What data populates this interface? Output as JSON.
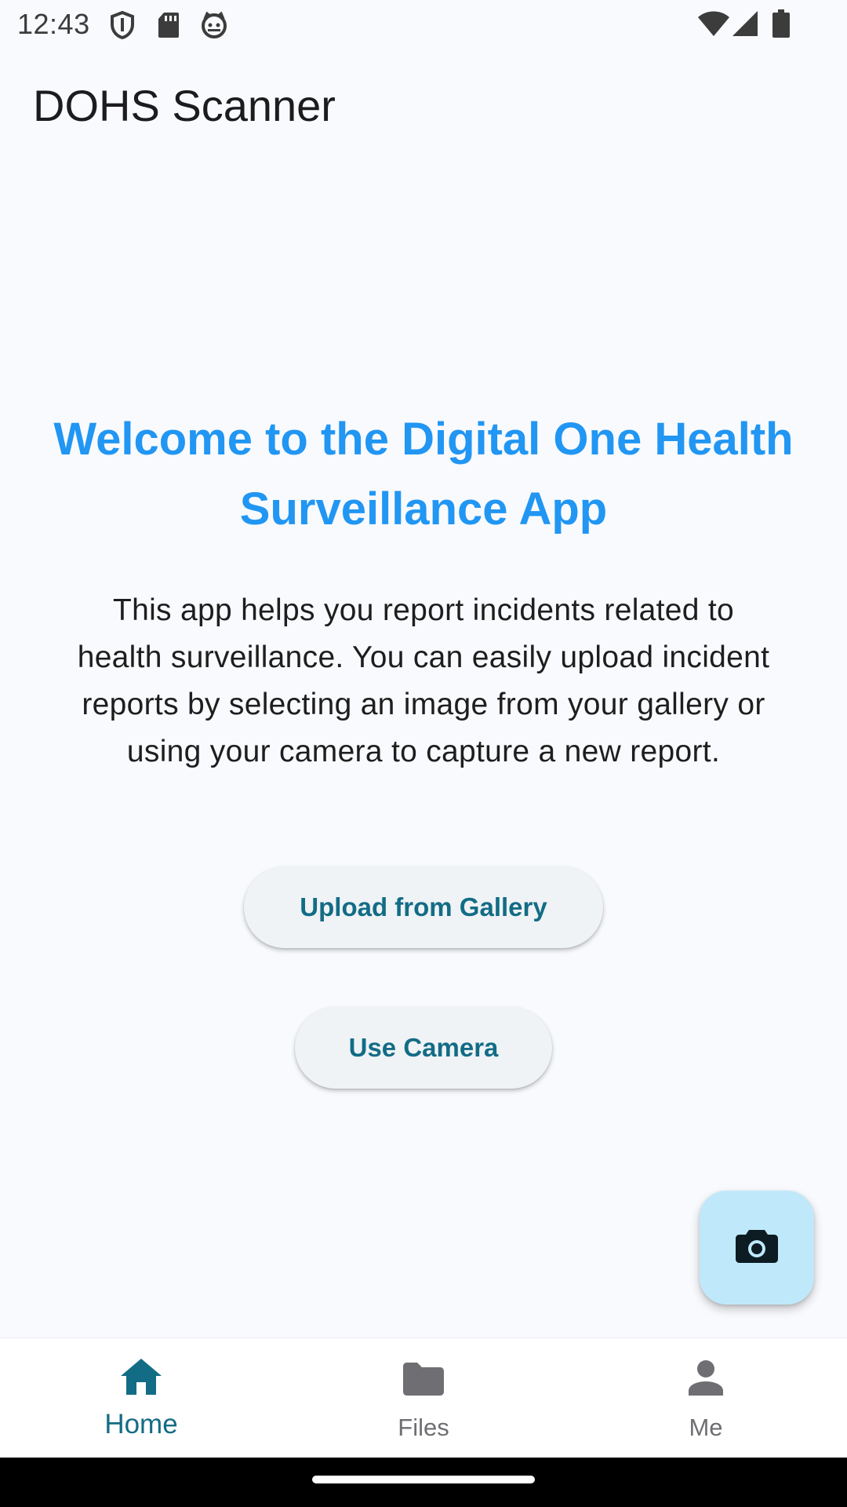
{
  "status_bar": {
    "time": "12:43",
    "left_icons": [
      "shield-icon",
      "sd-card-icon",
      "cat-face-icon"
    ],
    "right_icons": [
      "wifi-icon",
      "signal-icon",
      "battery-icon"
    ]
  },
  "app_bar": {
    "title": "DOHS Scanner"
  },
  "main": {
    "welcome_line1": "Welcome to the Digital One Health",
    "welcome_line2": "Surveillance App",
    "description_lines": [
      "This app helps you report incidents related to",
      "health surveillance. You can easily upload incident",
      "reports by selecting an image from your gallery or",
      "using your camera to capture a new report."
    ],
    "upload_button_label": "Upload from Gallery",
    "camera_button_label": "Use Camera"
  },
  "fab": {
    "icon": "camera-icon"
  },
  "bottom_nav": {
    "items": [
      {
        "label": "Home",
        "icon": "home-icon",
        "selected": true
      },
      {
        "label": "Files",
        "icon": "folder-icon",
        "selected": false
      },
      {
        "label": "Me",
        "icon": "person-icon",
        "selected": false
      }
    ]
  },
  "colors": {
    "accent": "#2196f3",
    "button_text": "#136c85",
    "fab_background": "#bfe9fb",
    "background": "#f9fafd"
  }
}
